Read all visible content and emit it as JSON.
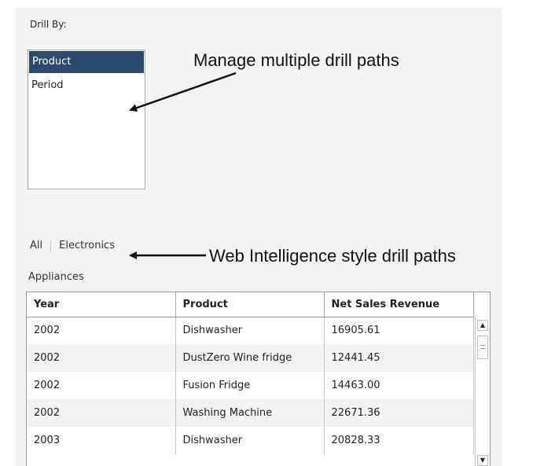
{
  "drill_panel": {
    "label": "Drill By:",
    "items": [
      {
        "label": "Product",
        "selected": true
      },
      {
        "label": "Period",
        "selected": false
      }
    ]
  },
  "breadcrumb": {
    "items": [
      "All",
      "Electronics"
    ],
    "current": "Appliances"
  },
  "table": {
    "columns": [
      "Year",
      "Product",
      "Net Sales Revenue"
    ],
    "rows": [
      [
        "2002",
        "Dishwasher",
        "16905.61"
      ],
      [
        "2002",
        "DustZero Wine fridge",
        "12441.45"
      ],
      [
        "2002",
        "Fusion Fridge",
        "14463.00"
      ],
      [
        "2002",
        "Washing Machine",
        "22671.36"
      ],
      [
        "2003",
        "Dishwasher",
        "20828.33"
      ]
    ]
  },
  "annotations": {
    "multi_drill": "Manage multiple drill paths",
    "webi_style": "Web Intelligence style drill paths"
  },
  "icons": {
    "scroll_up": "triangle-up",
    "scroll_down": "triangle-down",
    "scroll_thumb": "grip-lines"
  },
  "colors": {
    "selection": "#2c4a6d",
    "panel_background": "#f3f3f3"
  }
}
